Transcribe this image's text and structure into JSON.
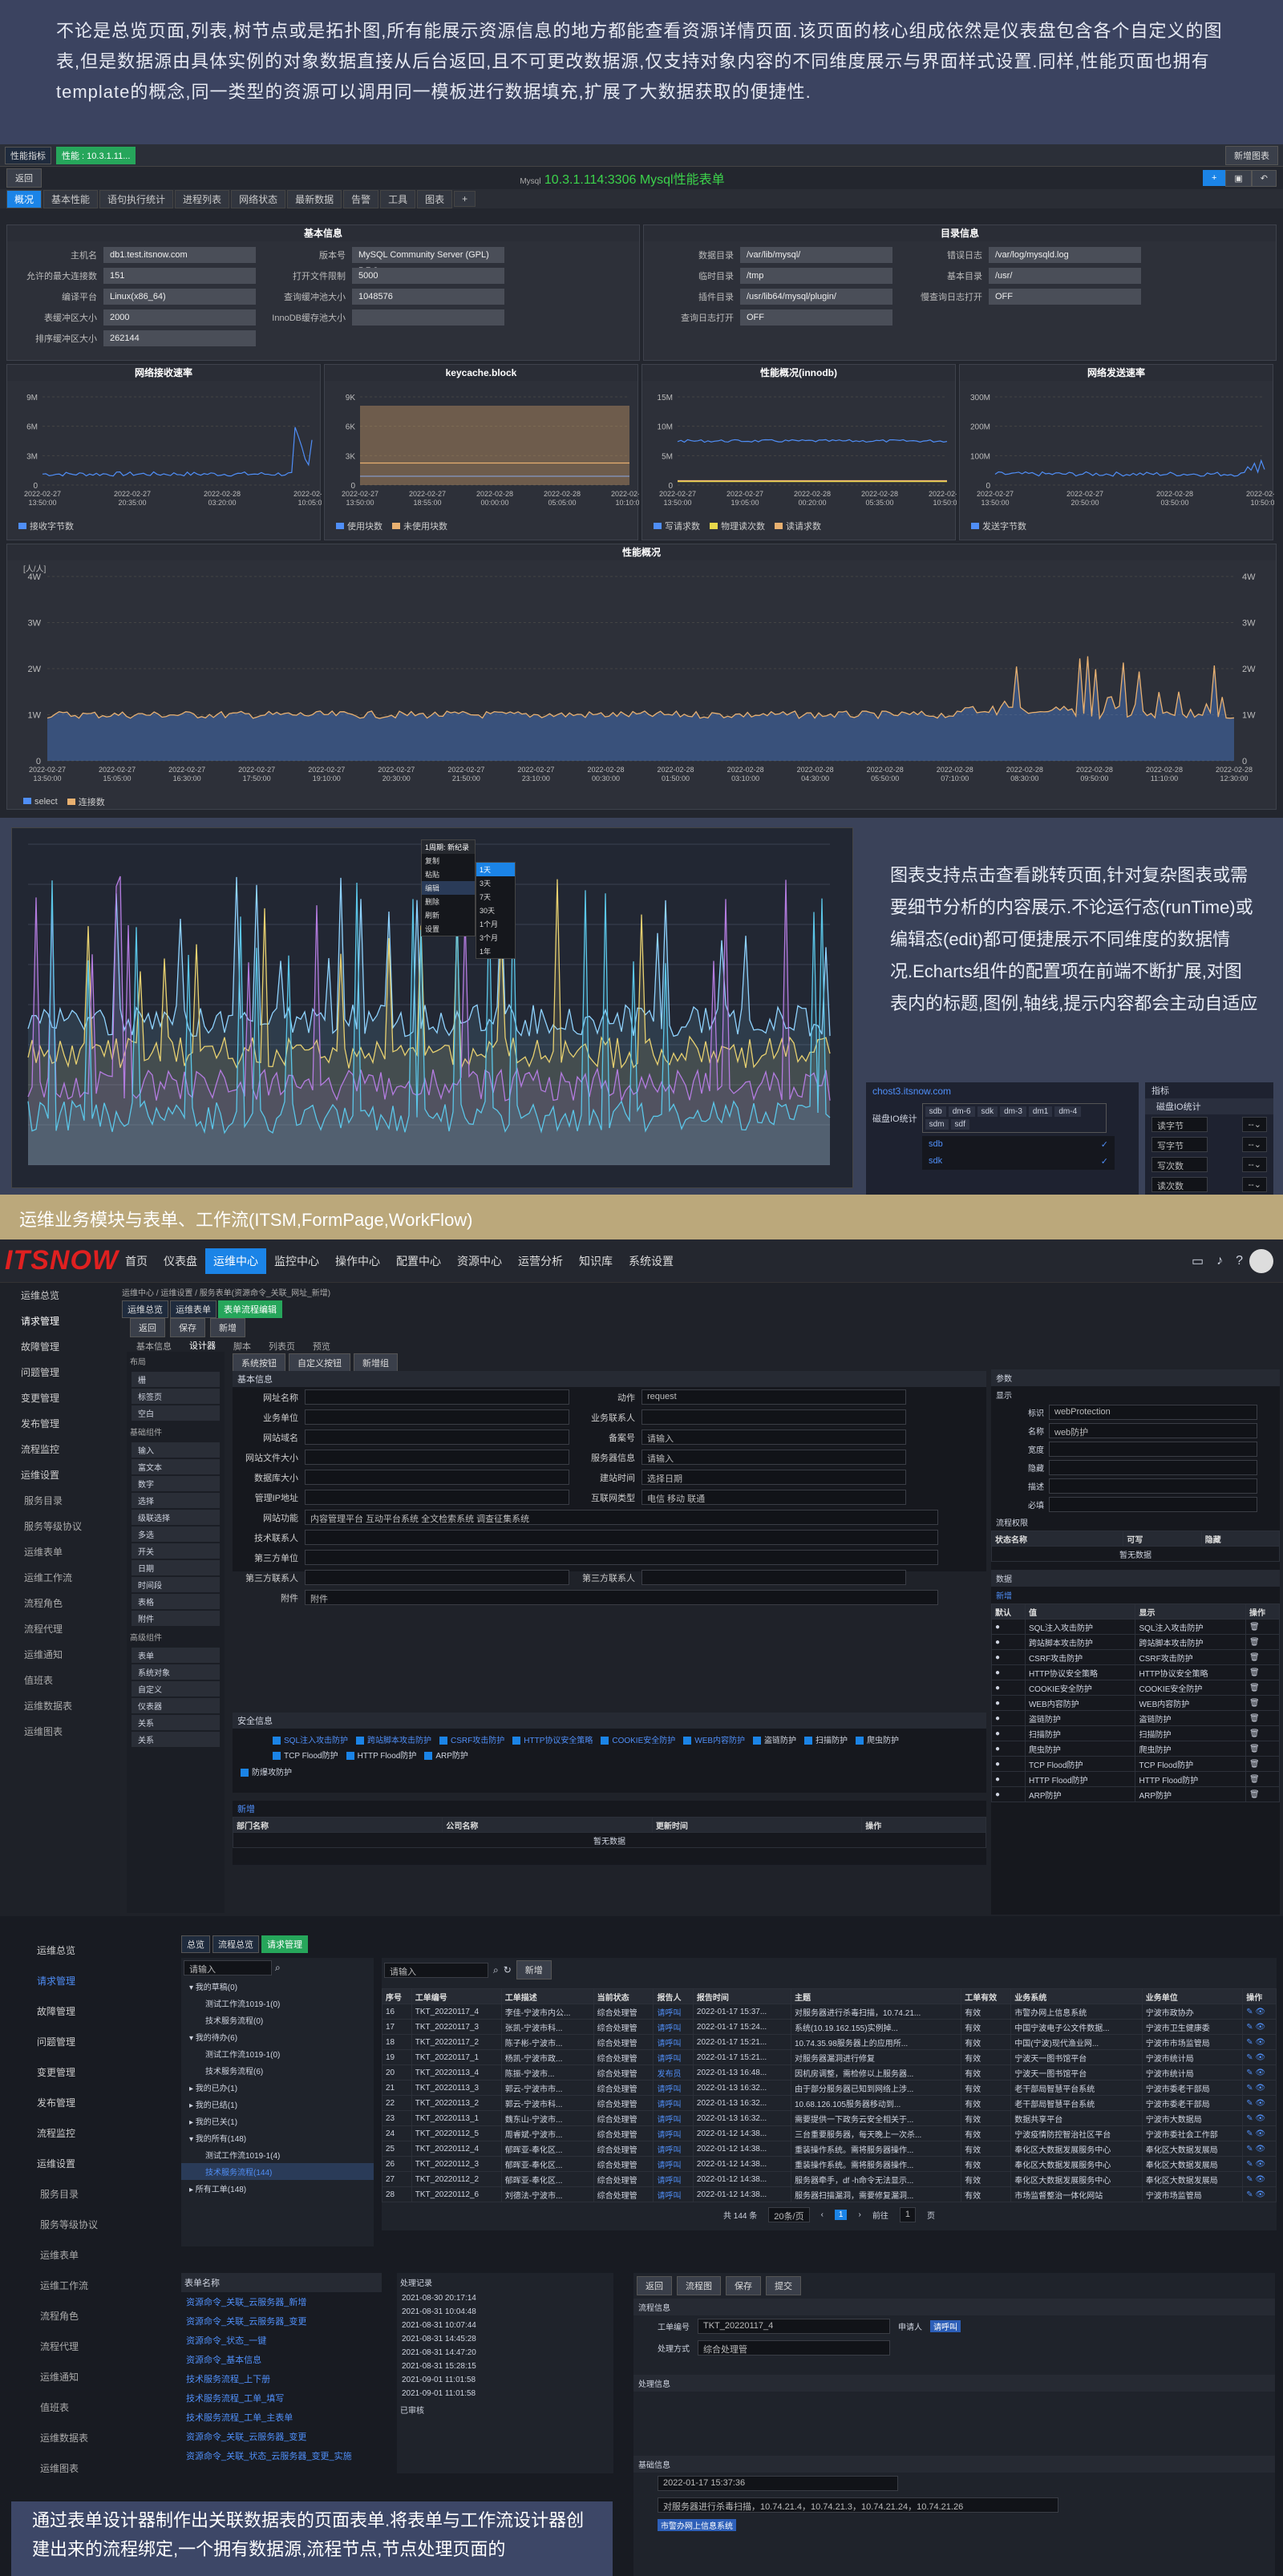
{
  "intro": {
    "text": "不论是总览页面,列表,树节点或是拓扑图,所有能展示资源信息的地方都能查看资源详情页面.该页面的核心组成依然是仪表盘包含各个自定义的图表,但是数据源由具体实例的对象数据直接从后台返回,且不可更改数据源,仅支持对象内容的不同维度展示与界面样式设置.同样,性能页面也拥有template的概念,同一类型的资源可以调用同一模板进行数据填充,扩展了大数据获取的便捷性."
  },
  "perf": {
    "topbar": {
      "tag1": "性能指标",
      "tag2": "性能 : 10.3.1.11...",
      "new": "新增图表",
      "back": "返回"
    },
    "title": "10.3.1.114:3306 Mysql性能表单",
    "mysql": "Mysql",
    "tabs": [
      "概况",
      "基本性能",
      "语句执行统计",
      "进程列表",
      "网络状态",
      "最新数据",
      "告警",
      "工具",
      "图表",
      "+"
    ],
    "basic": {
      "title": "基本信息",
      "rows": [
        {
          "k": "主机名",
          "v": "db1.test.itsnow.com",
          "k2": "版本号",
          "v2": "MySQL Community Server (GPL) 5.7.3"
        },
        {
          "k": "允许的最大连接数",
          "v": "151",
          "k2": "打开文件限制",
          "v2": "5000"
        },
        {
          "k": "编译平台",
          "v": "Linux(x86_64)",
          "k2": "查询缓冲池大小",
          "v2": "1048576"
        },
        {
          "k": "表缓冲区大小",
          "v": "2000",
          "k2": "InnoDB缓存池大小",
          "v2": ""
        },
        {
          "k": "排序缓冲区大小",
          "v": "262144",
          "k2": "",
          "v2": ""
        }
      ]
    },
    "dirs": {
      "title": "目录信息",
      "rows": [
        {
          "k": "数据目录",
          "v": "/var/lib/mysql/",
          "k2": "错误日志",
          "v2": "/var/log/mysqld.log"
        },
        {
          "k": "临时目录",
          "v": "/tmp",
          "k2": "基本目录",
          "v2": "/usr/"
        },
        {
          "k": "插件目录",
          "v": "/usr/lib64/mysql/plugin/",
          "k2": "慢查询日志打开",
          "v2": "OFF"
        },
        {
          "k": "查询日志打开",
          "v": "OFF",
          "k2": "",
          "v2": ""
        }
      ]
    },
    "charts": [
      {
        "title": "网络接收速率",
        "y": [
          "9M",
          "6M",
          "3M",
          "0"
        ],
        "x": [
          "2022-02-27\n13:50:00",
          "2022-02-27\n20:35:00",
          "2022-02-28\n03:20:00",
          "2022-02-28\n10:05:00"
        ],
        "legend": [
          {
            "name": "接收字节数",
            "color": "#4f8ef7"
          }
        ]
      },
      {
        "title": "keycache.block",
        "y": [
          "9K",
          "6K",
          "3K",
          "0"
        ],
        "x": [
          "2022-02-27\n13:50:00",
          "2022-02-27\n18:55:00",
          "2022-02-28\n00:00:00",
          "2022-02-28\n05:05:00",
          "2022-02-28\n10:10:00"
        ],
        "legend": [
          {
            "name": "使用块数",
            "color": "#4f8ef7"
          },
          {
            "name": "未使用块数",
            "color": "#e8b070"
          }
        ]
      },
      {
        "title": "性能概况(innodb)",
        "y": [
          "15M",
          "10M",
          "5M",
          "0"
        ],
        "x": [
          "2022-02-27\n13:50:00",
          "2022-02-27\n19:05:00",
          "2022-02-28\n00:20:00",
          "2022-02-28\n05:35:00",
          "2022-02-28\n10:50:00"
        ],
        "legend": [
          {
            "name": "写请求数",
            "color": "#4f8ef7"
          },
          {
            "name": "物理读次数",
            "color": "#e8d84a"
          },
          {
            "name": "读请求数",
            "color": "#e8b070"
          }
        ]
      },
      {
        "title": "网络发送速率",
        "y": [
          "300M",
          "200M",
          "100M",
          "0"
        ],
        "x": [
          "2022-02-27\n13:50:00",
          "2022-02-27\n20:50:00",
          "2022-02-28\n03:50:00",
          "2022-02-28\n10:50:00"
        ],
        "legend": [
          {
            "name": "发送字节数",
            "color": "#4f8ef7"
          }
        ]
      }
    ],
    "big": {
      "title": "性能概况",
      "unit": "[人/人]",
      "y": [
        "4W",
        "3W",
        "2W",
        "1W",
        "0"
      ],
      "x": [
        "2022-02-27\n13:50:00",
        "2022-02-27\n15:05:00",
        "2022-02-27\n16:30:00",
        "2022-02-27\n17:50:00",
        "2022-02-27\n19:10:00",
        "2022-02-27\n20:30:00",
        "2022-02-27\n21:50:00",
        "2022-02-27\n23:10:00",
        "2022-02-28\n00:30:00",
        "2022-02-28\n01:50:00",
        "2022-02-28\n03:10:00",
        "2022-02-28\n04:30:00",
        "2022-02-28\n05:50:00",
        "2022-02-28\n07:10:00",
        "2022-02-28\n08:30:00",
        "2022-02-28\n09:50:00",
        "2022-02-28\n11:10:00",
        "2022-02-28\n12:30:00"
      ],
      "legend": [
        {
          "name": "select",
          "color": "#4f8ef7"
        },
        {
          "name": "连接数",
          "color": "#e8b070"
        }
      ]
    }
  },
  "sec2": {
    "text": "图表支持点击查看跳转页面,针对复杂图表或需要细节分析的内容展示.不论运行态(runTime)或编辑态(edit)都可便捷展示不同维度的数据情况.Echarts组件的配置项在前端不断扩展,对图表内的标题,图例,轴线,提示内容都会主动自适应",
    "menu": [
      "复制",
      "粘贴",
      "编辑",
      "删除",
      "刷新",
      "设置"
    ],
    "submenu": [
      "1天",
      "3天",
      "7天",
      "30天",
      "1个月",
      "3个月",
      "1年"
    ],
    "ctxtitle": "1周期: 新纪录",
    "host": "chost3.itsnow.com",
    "disk_label": "磁盘IO统计",
    "disks": [
      "sdb",
      "dm-6",
      "sdk",
      "dm-3",
      "dm1",
      "dm-4",
      "sdm",
      "sdf"
    ],
    "opts": [
      "sdb",
      "sdk"
    ],
    "metric": {
      "title": "指标",
      "sub": "磁盘IO统计",
      "items": [
        "读字节",
        "写字节",
        "写次数",
        "读次数"
      ]
    }
  },
  "sec3": {
    "heading": "运维业务模块与表单、工作流(ITSM,FormPage,WorkFlow)",
    "logo": "ITSNOW",
    "nav": [
      "首页",
      "仪表盘",
      "运维中心",
      "监控中心",
      "操作中心",
      "配置中心",
      "资源中心",
      "运营分析",
      "知识库",
      "系统设置"
    ],
    "side": [
      "运维总览",
      "请求管理",
      "故障管理",
      "问题管理",
      "变更管理",
      "发布管理",
      "流程监控",
      "运维设置",
      "服务目录",
      "服务等级协议",
      "运维表单",
      "运维工作流",
      "流程角色",
      "流程代理",
      "运维通知",
      "值班表",
      "运维数据表",
      "运维图表"
    ],
    "crumbs": [
      "运维中心",
      "运维设置",
      "服务表单(资源命令_关联_网址_新增)"
    ],
    "toptabs": [
      "运维总览",
      "运维表单",
      "表单流程编辑"
    ],
    "actions": [
      "返回",
      "保存",
      "新增"
    ],
    "subtabs": [
      "基本信息",
      "设计器",
      "脚本",
      "列表页",
      "预览"
    ],
    "libTitle": "布局",
    "lib": [
      "栅",
      "标签页",
      "空白"
    ],
    "libTitle2": "基础组件",
    "lib2": [
      "输入",
      "富文本",
      "数字",
      "选择",
      "级联选择",
      "多选",
      "开关",
      "日期",
      "时间段",
      "表格",
      "附件"
    ],
    "libTitle3": "高级组件",
    "lib3": [
      "表单",
      "系统对象",
      "自定义",
      "仪表器",
      "关系",
      "关系"
    ],
    "toolbar": [
      "系统按钮",
      "自定义按钮",
      "新增组"
    ],
    "formTitle": "基本信息",
    "fields": [
      [
        "网址名称",
        "",
        "动作",
        "request"
      ],
      [
        "业务单位",
        "",
        "业务联系人",
        ""
      ],
      [
        "网站域名",
        "",
        "备案号",
        "请输入"
      ],
      [
        "网站文件大小",
        "",
        "服务器信息",
        "请输入"
      ],
      [
        "数据库大小",
        "",
        "建站时间",
        "选择日期"
      ],
      [
        "管理IP地址",
        "",
        "互联网类型",
        "电信 移动 联通"
      ],
      [
        "网站功能",
        "内容管理平台 互动平台系统 全文检索系统 调查征集系统",
        ""
      ],
      [
        "技术联系人",
        "",
        "",
        ""
      ],
      [
        "第三方单位",
        "",
        "",
        ""
      ],
      [
        "第三方联系人",
        "",
        "第三方联系人",
        ""
      ],
      [
        "附件",
        "附件",
        "",
        ""
      ]
    ],
    "secTitle": "安全信息",
    "secOpts": [
      "SQL注入攻击防护",
      "跨站脚本攻击防护",
      "CSRF攻击防护",
      "HTTP协议安全策略",
      "COOKIE安全防护",
      "WEB内容防护",
      "盗链防护",
      "扫描防护",
      "爬虫防护",
      "TCP Flood防护",
      "HTTP Flood防护",
      "ARP防护"
    ],
    "secEnable": "防爆攻防护",
    "table2": {
      "new": "新增",
      "cols": [
        "部门名称",
        "公司名称",
        "更新时间",
        "操作"
      ],
      "empty": "暂无数据"
    },
    "prop": {
      "title": "参数",
      "show": "显示",
      "ident": "标识",
      "identv": "webProtection",
      "name": "名称",
      "namev": "web防护",
      "width": "宽度",
      "hidden": "隐藏",
      "desc": "描述",
      "must": "必填",
      "flow": "流程权限",
      "cols": [
        "状态名称",
        "可写",
        "隐藏"
      ],
      "empty": "暂无数据",
      "data": "数据",
      "model": "必填",
      "add": "新增",
      "tcols": [
        "默认",
        "值",
        "显示",
        "操作"
      ],
      "rows": [
        "SQL注入攻击防护",
        "跨站脚本攻击防护",
        "CSRF攻击防护",
        "HTTP协议安全策略",
        "COOKIE安全防护",
        "WEB内容防护",
        "盗链防护",
        "扫描防护",
        "爬虫防护",
        "TCP Flood防护",
        "HTTP Flood防护",
        "ARP防护"
      ]
    }
  },
  "sec4": {
    "side": [
      "运维总览",
      "请求管理",
      "故障管理",
      "问题管理",
      "变更管理",
      "发布管理",
      "流程监控",
      "运维设置",
      "服务目录",
      "服务等级协议",
      "运维表单",
      "运维工作流",
      "流程角色",
      "流程代理",
      "运维通知",
      "值班表",
      "运维数据表",
      "运维图表"
    ],
    "tabs": [
      "总览",
      "流程总览",
      "请求管理"
    ],
    "searchPh": "请输入",
    "newBtn": "新增",
    "tree": [
      "▾ 我的草稿(0)",
      "测试工作流1019-1(0)",
      "技术服务流程(0)",
      "▾ 我的待办(6)",
      "测试工作流1019-1(0)",
      "技术服务流程(6)",
      "▸ 我的已办(1)",
      "▸ 我的已结(1)",
      "▸ 我的已关(1)",
      "▾ 我的所有(148)",
      "测试工作流1019-1(4)",
      "技术服务流程(144)",
      "▸ 所有工单(148)"
    ],
    "cols": [
      "序号",
      "工单编号",
      "工单描述",
      "当前状态",
      "报告人",
      "报告时间",
      "主题",
      "工单有效",
      "业务系统",
      "业务单位",
      "操作"
    ],
    "rows": [
      [
        "16",
        "TKT_20220117_4",
        "李佳-宁波市内公...",
        "综合处理管",
        "请呼叫",
        "2022-01-17 15:37...",
        "对服务器进行杀毒扫描，10.74.21...",
        "有效",
        "市警办网上信息系统",
        "宁波市政协办"
      ],
      [
        "17",
        "TKT_20220117_3",
        "张凯-宁波市科...",
        "综合处理管",
        "请呼叫",
        "2022-01-17 15:24...",
        "系统(10.19.162.155)实例掉...",
        "有效",
        "中国宁波电子公文件数据...",
        "宁波市卫生健康委"
      ],
      [
        "18",
        "TKT_20220117_2",
        "陈子彬-宁波市...",
        "综合处理管",
        "请呼叫",
        "2022-01-17 15:21...",
        "10.74.35.98服务器上的应用所...",
        "有效",
        "中国(宁波)现代渔业网...",
        "宁波市市场监管局"
      ],
      [
        "19",
        "TKT_20220117_1",
        "杨凯-宁波市政...",
        "综合处理管",
        "请呼叫",
        "2022-01-17 15:21...",
        "对服务器漏洞进行修复",
        "有效",
        "宁波天一图书馆平台",
        "宁波市统计局"
      ],
      [
        "20",
        "TKT_20220113_4",
        "陈振-宁波市...",
        "综合处理管",
        "发布员",
        "2022-01-13 16:48...",
        "因机房调整，需检修以上服务器...",
        "有效",
        "宁波天一图书馆平台",
        "宁波市统计局"
      ],
      [
        "21",
        "TKT_20220113_3",
        "郭云-宁波市市...",
        "综合处理管",
        "请呼叫",
        "2022-01-13 16:32...",
        "由于部分服务器已知到网络上涉...",
        "有效",
        "老干部局智慧平台系统",
        "宁波市委老干部局"
      ],
      [
        "22",
        "TKT_20220113_2",
        "郭云-宁波市科...",
        "综合处理管",
        "请呼叫",
        "2022-01-13 16:32...",
        "10.68.126.105服务器移动到...",
        "有效",
        "老干部局智慧平台系统",
        "宁波市委老干部局"
      ],
      [
        "23",
        "TKT_20220113_1",
        "魏东山-宁波市...",
        "综合处理管",
        "请呼叫",
        "2022-01-13 16:32...",
        "需要提供一下政务云安全相关于...",
        "有效",
        "数据共享平台",
        "宁波市大数据局"
      ],
      [
        "24",
        "TKT_20220112_5",
        "周睿斌-宁波市...",
        "综合处理管",
        "请呼叫",
        "2022-01-12 14:38...",
        "三台重要服务器，每天晚上一次杀...",
        "有效",
        "宁波疫情防控智治社区平台",
        "宁波市委社会工作部"
      ],
      [
        "25",
        "TKT_20220112_4",
        "郁晖亚-奉化区...",
        "综合处理管",
        "请呼叫",
        "2022-01-12 14:38...",
        "重装操作系统。需将服务器操作...",
        "有效",
        "奉化区大数据发展服务中心",
        "奉化区大数据发展局"
      ],
      [
        "26",
        "TKT_20220112_3",
        "郁晖亚-奉化区...",
        "综合处理管",
        "请呼叫",
        "2022-01-12 14:38...",
        "重装操作系统。需将服务器操作...",
        "有效",
        "奉化区大数据发展服务中心",
        "奉化区大数据发展局"
      ],
      [
        "27",
        "TKT_20220112_2",
        "郁晖亚-奉化区...",
        "综合处理管",
        "请呼叫",
        "2022-01-12 14:38...",
        "服务器牵手，df -h命令无法显示...",
        "有效",
        "奉化区大数据发展服务中心",
        "奉化区大数据发展局"
      ],
      [
        "28",
        "TKT_20220112_6",
        "刘德法-宁波市...",
        "综合处理管",
        "请呼叫",
        "2022-01-12 14:38...",
        "服务器扫描漏洞，需要修复漏洞...",
        "有效",
        "市场监督整治一体化网站",
        "宁波市场监管局"
      ]
    ],
    "pager": {
      "total": "共 144 条",
      "size": "20条/页",
      "page": "1",
      "goto": "前往",
      "gotoVal": "1",
      "unit": "页"
    },
    "formList": {
      "title": "表单名称",
      "items": [
        "资源命令_关联_云服务器_新增",
        "资源命令_关联_云服务器_变更",
        "资源命令_状态_一键",
        "资源命令_基本信息",
        "技术服务流程_上下册",
        "技术服务流程_工单_填写",
        "技术服务流程_工单_主表单",
        "资源命令_关联_云服务器_变更",
        "资源命令_关联_状态_云服务器_变更_实施"
      ]
    },
    "log": {
      "title": "处理记录",
      "rows": [
        "2021-08-30 20:17:14",
        "2021-08-31 10:04:48",
        "2021-08-31 10:07:44",
        "2021-08-31 14:45:28",
        "2021-08-31 14:47:20",
        "2021-08-31 15:28:15",
        "2021-09-01 11:01:58",
        "2021-09-01 11:01:58"
      ],
      "end": "已审核"
    },
    "caption": "通过表单设计器制作出关联数据表的页面表单.将表单与工作流设计器创建出来的流程绑定,一个拥有数据源,流程节点,节点处理页面的",
    "detail": {
      "btns": [
        "返回",
        "流程图",
        "保存",
        "提交"
      ],
      "s1": "流程信息",
      "ticketLbl": "工单编号",
      "ticket": "TKT_20220117_4",
      "reqLbl": "申请人",
      "req": "请呼叫",
      "procLbl": "处理方式",
      "proc": "综合处理管",
      "s2": "处理信息",
      "s3": "基础信息",
      "time": "2022-01-17 15:37:36",
      "subject": "对服务器进行杀毒扫描，10.74.21.4，10.74.21.3，10.74.21.24，10.74.21.26",
      "biz": "市警办网上信息系统"
    }
  }
}
